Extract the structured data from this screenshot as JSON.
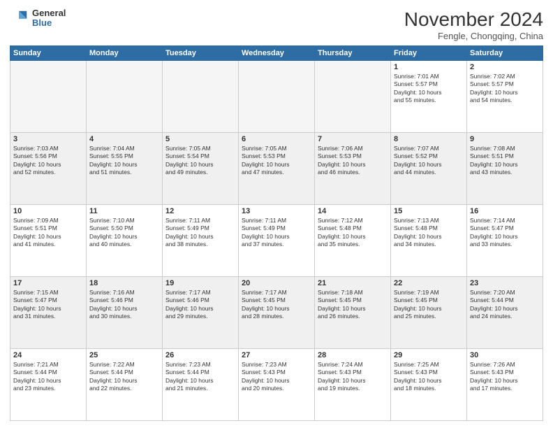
{
  "header": {
    "logo_general": "General",
    "logo_blue": "Blue",
    "month_year": "November 2024",
    "location": "Fengle, Chongqing, China"
  },
  "weekdays": [
    "Sunday",
    "Monday",
    "Tuesday",
    "Wednesday",
    "Thursday",
    "Friday",
    "Saturday"
  ],
  "weeks": [
    [
      {
        "day": "",
        "info": "",
        "empty": true
      },
      {
        "day": "",
        "info": "",
        "empty": true
      },
      {
        "day": "",
        "info": "",
        "empty": true
      },
      {
        "day": "",
        "info": "",
        "empty": true
      },
      {
        "day": "",
        "info": "",
        "empty": true
      },
      {
        "day": "1",
        "info": "Sunrise: 7:01 AM\nSunset: 5:57 PM\nDaylight: 10 hours\nand 55 minutes."
      },
      {
        "day": "2",
        "info": "Sunrise: 7:02 AM\nSunset: 5:57 PM\nDaylight: 10 hours\nand 54 minutes."
      }
    ],
    [
      {
        "day": "3",
        "info": "Sunrise: 7:03 AM\nSunset: 5:56 PM\nDaylight: 10 hours\nand 52 minutes."
      },
      {
        "day": "4",
        "info": "Sunrise: 7:04 AM\nSunset: 5:55 PM\nDaylight: 10 hours\nand 51 minutes."
      },
      {
        "day": "5",
        "info": "Sunrise: 7:05 AM\nSunset: 5:54 PM\nDaylight: 10 hours\nand 49 minutes."
      },
      {
        "day": "6",
        "info": "Sunrise: 7:05 AM\nSunset: 5:53 PM\nDaylight: 10 hours\nand 47 minutes."
      },
      {
        "day": "7",
        "info": "Sunrise: 7:06 AM\nSunset: 5:53 PM\nDaylight: 10 hours\nand 46 minutes."
      },
      {
        "day": "8",
        "info": "Sunrise: 7:07 AM\nSunset: 5:52 PM\nDaylight: 10 hours\nand 44 minutes."
      },
      {
        "day": "9",
        "info": "Sunrise: 7:08 AM\nSunset: 5:51 PM\nDaylight: 10 hours\nand 43 minutes."
      }
    ],
    [
      {
        "day": "10",
        "info": "Sunrise: 7:09 AM\nSunset: 5:51 PM\nDaylight: 10 hours\nand 41 minutes."
      },
      {
        "day": "11",
        "info": "Sunrise: 7:10 AM\nSunset: 5:50 PM\nDaylight: 10 hours\nand 40 minutes."
      },
      {
        "day": "12",
        "info": "Sunrise: 7:11 AM\nSunset: 5:49 PM\nDaylight: 10 hours\nand 38 minutes."
      },
      {
        "day": "13",
        "info": "Sunrise: 7:11 AM\nSunset: 5:49 PM\nDaylight: 10 hours\nand 37 minutes."
      },
      {
        "day": "14",
        "info": "Sunrise: 7:12 AM\nSunset: 5:48 PM\nDaylight: 10 hours\nand 35 minutes."
      },
      {
        "day": "15",
        "info": "Sunrise: 7:13 AM\nSunset: 5:48 PM\nDaylight: 10 hours\nand 34 minutes."
      },
      {
        "day": "16",
        "info": "Sunrise: 7:14 AM\nSunset: 5:47 PM\nDaylight: 10 hours\nand 33 minutes."
      }
    ],
    [
      {
        "day": "17",
        "info": "Sunrise: 7:15 AM\nSunset: 5:47 PM\nDaylight: 10 hours\nand 31 minutes."
      },
      {
        "day": "18",
        "info": "Sunrise: 7:16 AM\nSunset: 5:46 PM\nDaylight: 10 hours\nand 30 minutes."
      },
      {
        "day": "19",
        "info": "Sunrise: 7:17 AM\nSunset: 5:46 PM\nDaylight: 10 hours\nand 29 minutes."
      },
      {
        "day": "20",
        "info": "Sunrise: 7:17 AM\nSunset: 5:45 PM\nDaylight: 10 hours\nand 28 minutes."
      },
      {
        "day": "21",
        "info": "Sunrise: 7:18 AM\nSunset: 5:45 PM\nDaylight: 10 hours\nand 26 minutes."
      },
      {
        "day": "22",
        "info": "Sunrise: 7:19 AM\nSunset: 5:45 PM\nDaylight: 10 hours\nand 25 minutes."
      },
      {
        "day": "23",
        "info": "Sunrise: 7:20 AM\nSunset: 5:44 PM\nDaylight: 10 hours\nand 24 minutes."
      }
    ],
    [
      {
        "day": "24",
        "info": "Sunrise: 7:21 AM\nSunset: 5:44 PM\nDaylight: 10 hours\nand 23 minutes."
      },
      {
        "day": "25",
        "info": "Sunrise: 7:22 AM\nSunset: 5:44 PM\nDaylight: 10 hours\nand 22 minutes."
      },
      {
        "day": "26",
        "info": "Sunrise: 7:23 AM\nSunset: 5:44 PM\nDaylight: 10 hours\nand 21 minutes."
      },
      {
        "day": "27",
        "info": "Sunrise: 7:23 AM\nSunset: 5:43 PM\nDaylight: 10 hours\nand 20 minutes."
      },
      {
        "day": "28",
        "info": "Sunrise: 7:24 AM\nSunset: 5:43 PM\nDaylight: 10 hours\nand 19 minutes."
      },
      {
        "day": "29",
        "info": "Sunrise: 7:25 AM\nSunset: 5:43 PM\nDaylight: 10 hours\nand 18 minutes."
      },
      {
        "day": "30",
        "info": "Sunrise: 7:26 AM\nSunset: 5:43 PM\nDaylight: 10 hours\nand 17 minutes."
      }
    ]
  ]
}
